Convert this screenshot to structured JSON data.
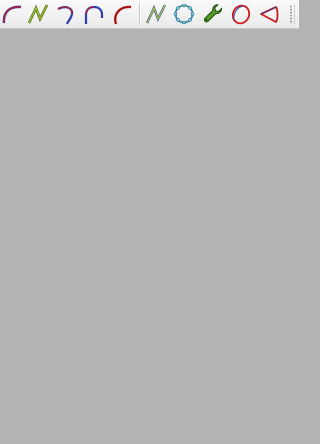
{
  "toolbar": {
    "buttons": [
      {
        "name": "arc-tool-button",
        "icon": "arc-icon"
      },
      {
        "name": "polyline-tool-button",
        "icon": "polyline-icon"
      },
      {
        "name": "curved-line-tool-button",
        "icon": "curved-line-icon"
      },
      {
        "name": "fillet-tool-button",
        "icon": "fillet-icon"
      },
      {
        "name": "three-point-arc-tool-button",
        "icon": "three-point-arc-icon"
      },
      {
        "name": "bspline-tool-button",
        "icon": "bspline-icon"
      },
      {
        "name": "polygon-tool-button",
        "icon": "polygon-icon"
      },
      {
        "name": "edit-tool-button",
        "icon": "wrench-icon"
      },
      {
        "name": "ellipse-tool-button",
        "icon": "ellipse-icon"
      },
      {
        "name": "slot-tool-button",
        "icon": "slot-icon"
      }
    ]
  },
  "colors": {
    "workspace": "#b3b3b3",
    "curve_red": "#cc1a1a",
    "curve_blue": "#2b3fb5",
    "curve_green": "#7a9a1a",
    "wrench_green": "#3f7f1f"
  }
}
